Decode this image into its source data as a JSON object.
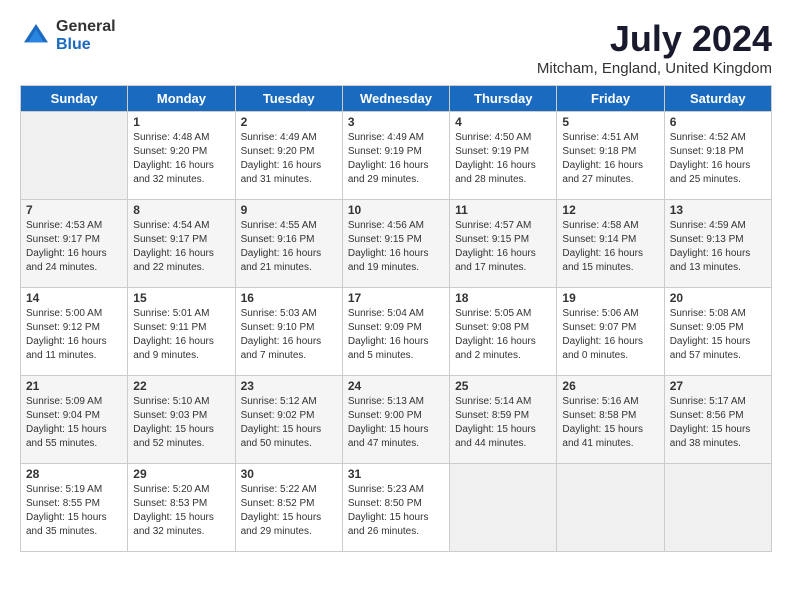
{
  "logo": {
    "general": "General",
    "blue": "Blue"
  },
  "title": "July 2024",
  "subtitle": "Mitcham, England, United Kingdom",
  "days_header": [
    "Sunday",
    "Monday",
    "Tuesday",
    "Wednesday",
    "Thursday",
    "Friday",
    "Saturday"
  ],
  "weeks": [
    [
      {
        "num": "",
        "info": ""
      },
      {
        "num": "1",
        "info": "Sunrise: 4:48 AM\nSunset: 9:20 PM\nDaylight: 16 hours\nand 32 minutes."
      },
      {
        "num": "2",
        "info": "Sunrise: 4:49 AM\nSunset: 9:20 PM\nDaylight: 16 hours\nand 31 minutes."
      },
      {
        "num": "3",
        "info": "Sunrise: 4:49 AM\nSunset: 9:19 PM\nDaylight: 16 hours\nand 29 minutes."
      },
      {
        "num": "4",
        "info": "Sunrise: 4:50 AM\nSunset: 9:19 PM\nDaylight: 16 hours\nand 28 minutes."
      },
      {
        "num": "5",
        "info": "Sunrise: 4:51 AM\nSunset: 9:18 PM\nDaylight: 16 hours\nand 27 minutes."
      },
      {
        "num": "6",
        "info": "Sunrise: 4:52 AM\nSunset: 9:18 PM\nDaylight: 16 hours\nand 25 minutes."
      }
    ],
    [
      {
        "num": "7",
        "info": "Sunrise: 4:53 AM\nSunset: 9:17 PM\nDaylight: 16 hours\nand 24 minutes."
      },
      {
        "num": "8",
        "info": "Sunrise: 4:54 AM\nSunset: 9:17 PM\nDaylight: 16 hours\nand 22 minutes."
      },
      {
        "num": "9",
        "info": "Sunrise: 4:55 AM\nSunset: 9:16 PM\nDaylight: 16 hours\nand 21 minutes."
      },
      {
        "num": "10",
        "info": "Sunrise: 4:56 AM\nSunset: 9:15 PM\nDaylight: 16 hours\nand 19 minutes."
      },
      {
        "num": "11",
        "info": "Sunrise: 4:57 AM\nSunset: 9:15 PM\nDaylight: 16 hours\nand 17 minutes."
      },
      {
        "num": "12",
        "info": "Sunrise: 4:58 AM\nSunset: 9:14 PM\nDaylight: 16 hours\nand 15 minutes."
      },
      {
        "num": "13",
        "info": "Sunrise: 4:59 AM\nSunset: 9:13 PM\nDaylight: 16 hours\nand 13 minutes."
      }
    ],
    [
      {
        "num": "14",
        "info": "Sunrise: 5:00 AM\nSunset: 9:12 PM\nDaylight: 16 hours\nand 11 minutes."
      },
      {
        "num": "15",
        "info": "Sunrise: 5:01 AM\nSunset: 9:11 PM\nDaylight: 16 hours\nand 9 minutes."
      },
      {
        "num": "16",
        "info": "Sunrise: 5:03 AM\nSunset: 9:10 PM\nDaylight: 16 hours\nand 7 minutes."
      },
      {
        "num": "17",
        "info": "Sunrise: 5:04 AM\nSunset: 9:09 PM\nDaylight: 16 hours\nand 5 minutes."
      },
      {
        "num": "18",
        "info": "Sunrise: 5:05 AM\nSunset: 9:08 PM\nDaylight: 16 hours\nand 2 minutes."
      },
      {
        "num": "19",
        "info": "Sunrise: 5:06 AM\nSunset: 9:07 PM\nDaylight: 16 hours\nand 0 minutes."
      },
      {
        "num": "20",
        "info": "Sunrise: 5:08 AM\nSunset: 9:05 PM\nDaylight: 15 hours\nand 57 minutes."
      }
    ],
    [
      {
        "num": "21",
        "info": "Sunrise: 5:09 AM\nSunset: 9:04 PM\nDaylight: 15 hours\nand 55 minutes."
      },
      {
        "num": "22",
        "info": "Sunrise: 5:10 AM\nSunset: 9:03 PM\nDaylight: 15 hours\nand 52 minutes."
      },
      {
        "num": "23",
        "info": "Sunrise: 5:12 AM\nSunset: 9:02 PM\nDaylight: 15 hours\nand 50 minutes."
      },
      {
        "num": "24",
        "info": "Sunrise: 5:13 AM\nSunset: 9:00 PM\nDaylight: 15 hours\nand 47 minutes."
      },
      {
        "num": "25",
        "info": "Sunrise: 5:14 AM\nSunset: 8:59 PM\nDaylight: 15 hours\nand 44 minutes."
      },
      {
        "num": "26",
        "info": "Sunrise: 5:16 AM\nSunset: 8:58 PM\nDaylight: 15 hours\nand 41 minutes."
      },
      {
        "num": "27",
        "info": "Sunrise: 5:17 AM\nSunset: 8:56 PM\nDaylight: 15 hours\nand 38 minutes."
      }
    ],
    [
      {
        "num": "28",
        "info": "Sunrise: 5:19 AM\nSunset: 8:55 PM\nDaylight: 15 hours\nand 35 minutes."
      },
      {
        "num": "29",
        "info": "Sunrise: 5:20 AM\nSunset: 8:53 PM\nDaylight: 15 hours\nand 32 minutes."
      },
      {
        "num": "30",
        "info": "Sunrise: 5:22 AM\nSunset: 8:52 PM\nDaylight: 15 hours\nand 29 minutes."
      },
      {
        "num": "31",
        "info": "Sunrise: 5:23 AM\nSunset: 8:50 PM\nDaylight: 15 hours\nand 26 minutes."
      },
      {
        "num": "",
        "info": ""
      },
      {
        "num": "",
        "info": ""
      },
      {
        "num": "",
        "info": ""
      }
    ]
  ]
}
